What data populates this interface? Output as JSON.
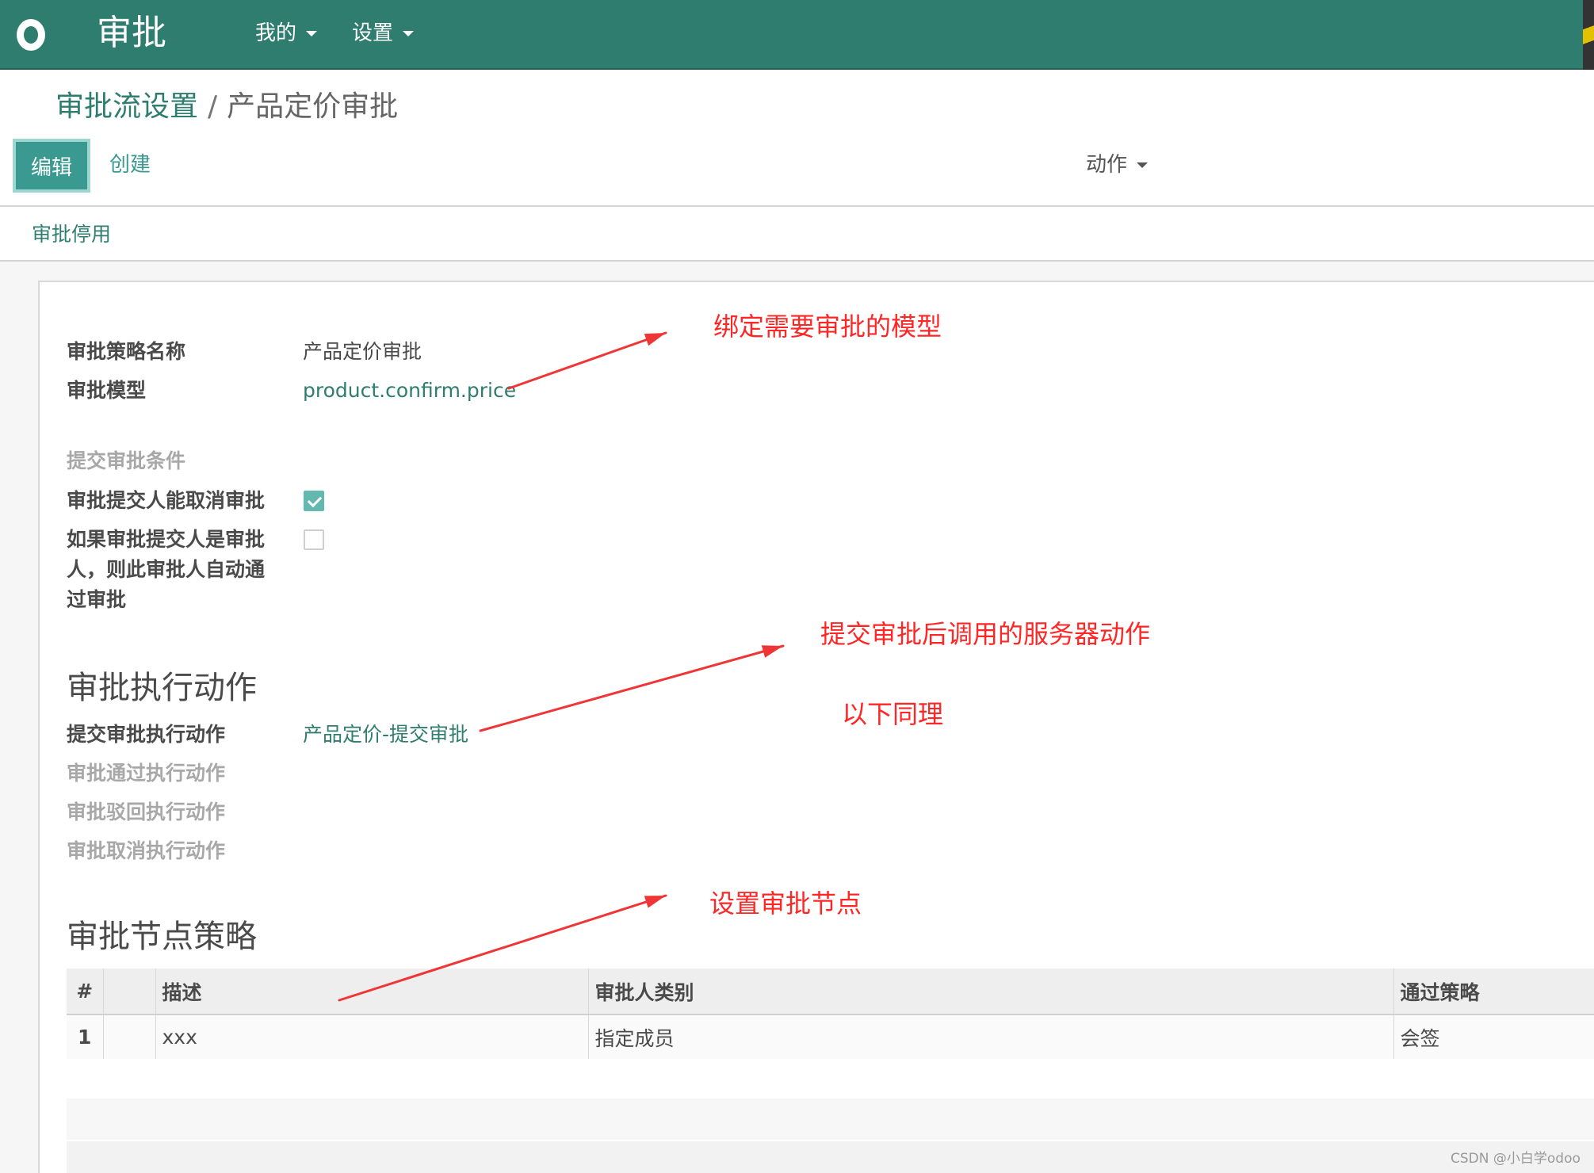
{
  "navbar": {
    "app_title": "审批",
    "menus": [
      "我的",
      "设置"
    ]
  },
  "control_panel": {
    "breadcrumb_parent": "审批流设置",
    "breadcrumb_sep": "/",
    "breadcrumb_current": "产品定价审批",
    "edit_label": "编辑",
    "create_label": "创建",
    "action_label": "动作"
  },
  "statusbar": {
    "disable_label": "审批停用"
  },
  "form": {
    "policy_name_label": "审批策略名称",
    "policy_name_value": "产品定价审批",
    "model_label": "审批模型",
    "model_value": "product.confirm.price",
    "submit_condition_label": "提交审批条件",
    "submitter_cancel_label": "审批提交人能取消审批",
    "submitter_cancel_checked": true,
    "auto_approve_label_lines": [
      "如果审批提交人是审批",
      "人，则此审批人自动通",
      "过审批"
    ],
    "auto_approve_checked": false,
    "actions_section_title": "审批执行动作",
    "submit_action_label": "提交审批执行动作",
    "submit_action_value": "产品定价-提交审批",
    "approve_action_label": "审批通过执行动作",
    "reject_action_label": "审批驳回执行动作",
    "cancel_action_label": "审批取消执行动作",
    "nodes_section_title": "审批节点策略"
  },
  "nodes_table": {
    "columns": [
      "#",
      "",
      "描述",
      "审批人类别",
      "通过策略"
    ],
    "rows": [
      {
        "index": "1",
        "handle": "",
        "description": "xxx",
        "approver_type": "指定成员",
        "pass_policy": "会签"
      }
    ]
  },
  "annotations": {
    "model_note": "绑定需要审批的模型",
    "action_note": "提交审批后调用的服务器动作",
    "same_note": "以下同理",
    "node_note": "设置审批节点",
    "arrow_color": "#ef3535"
  },
  "watermark": "CSDN @小白学odoo"
}
